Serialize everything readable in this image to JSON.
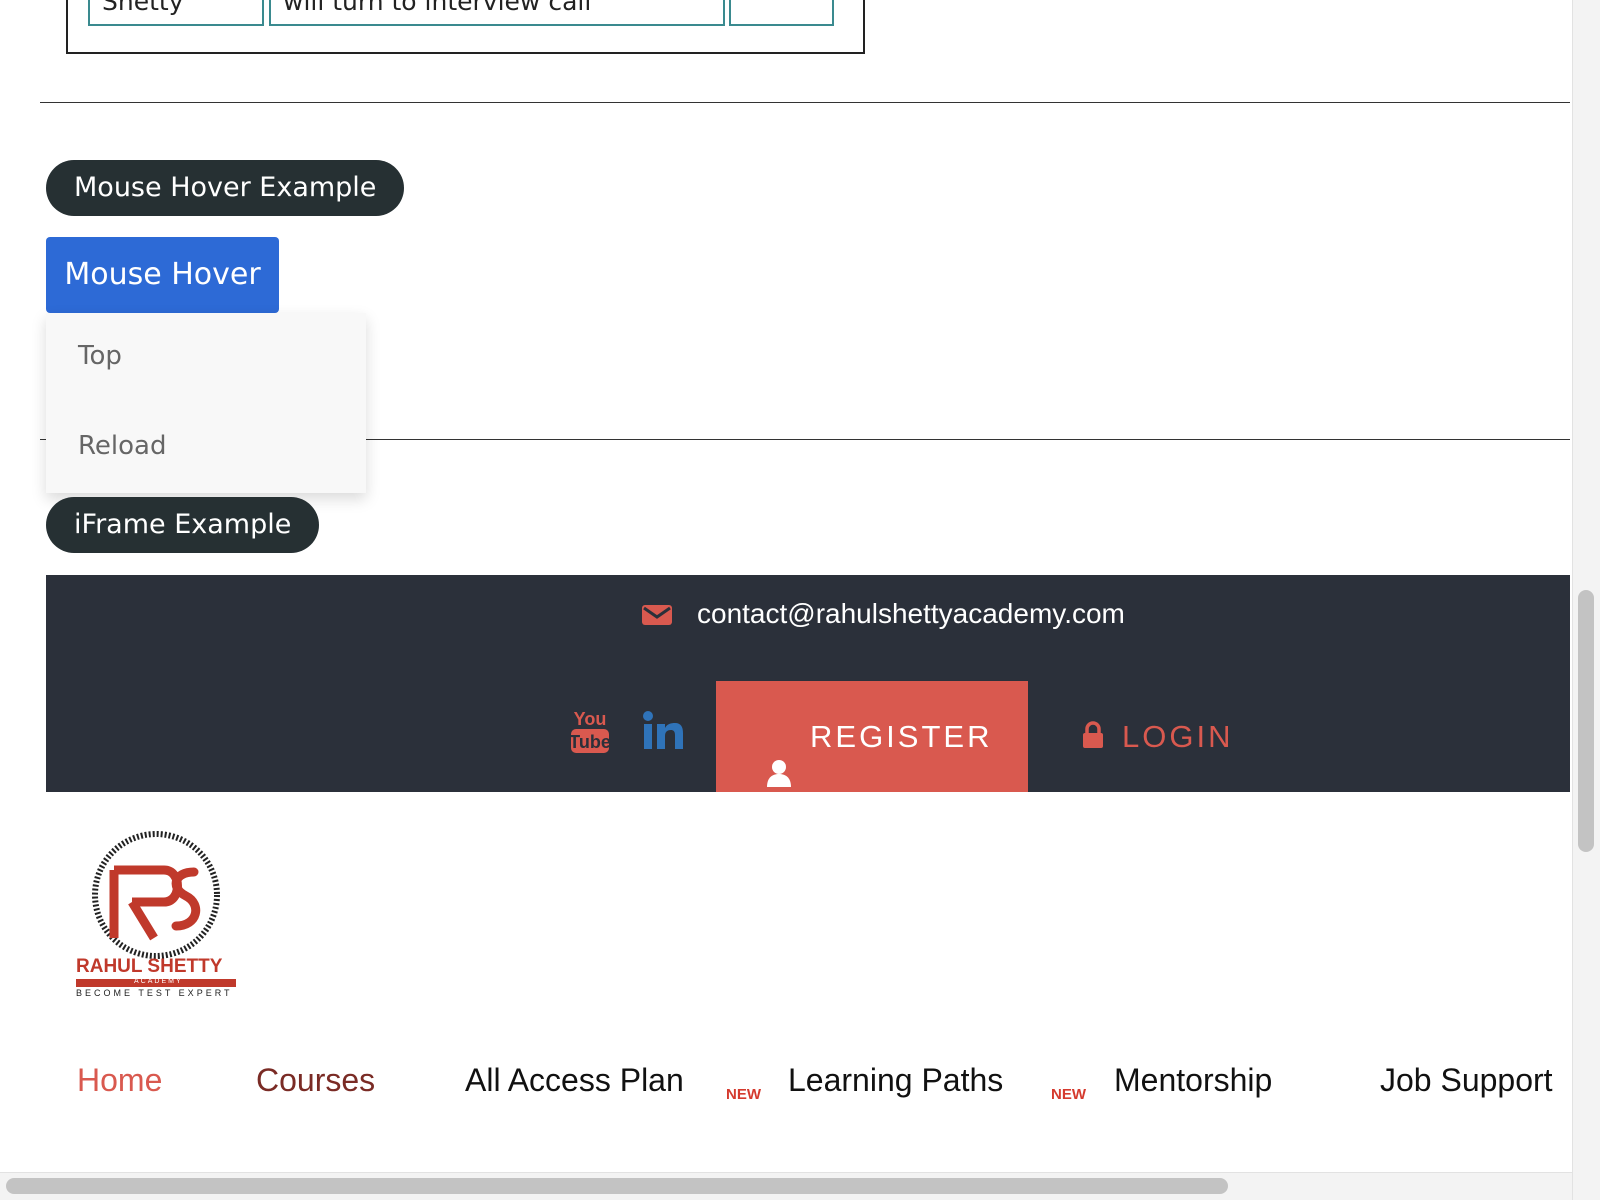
{
  "table": {
    "cells": [
      "Shetty",
      "will turn to interview call",
      ""
    ]
  },
  "mouse_hover_section": {
    "heading": "Mouse Hover Example",
    "button_label": "Mouse Hover",
    "menu_items": [
      "Top",
      "Reload"
    ]
  },
  "iframe_section": {
    "heading": "iFrame Example"
  },
  "footer": {
    "email": "contact@rahulshettyacademy.com",
    "register_label": "REGISTER",
    "login_label": "LOGIN",
    "social": [
      "youtube-icon",
      "linkedin-icon"
    ]
  },
  "brand": {
    "name": "RAHUL SHETTY",
    "sub": "ACADEMY",
    "tagline": "BECOME TEST EXPERT",
    "color": "#c0392b"
  },
  "nav": {
    "items": [
      "Home",
      "Courses",
      "All Access Plan",
      "Learning Paths",
      "Mentorship",
      "Job Support"
    ],
    "badge": "NEW"
  },
  "colors": {
    "accent": "#d9594f",
    "footer_bg": "#2b303a",
    "button_blue": "#2d6ad6",
    "pill_bg": "#263033"
  }
}
